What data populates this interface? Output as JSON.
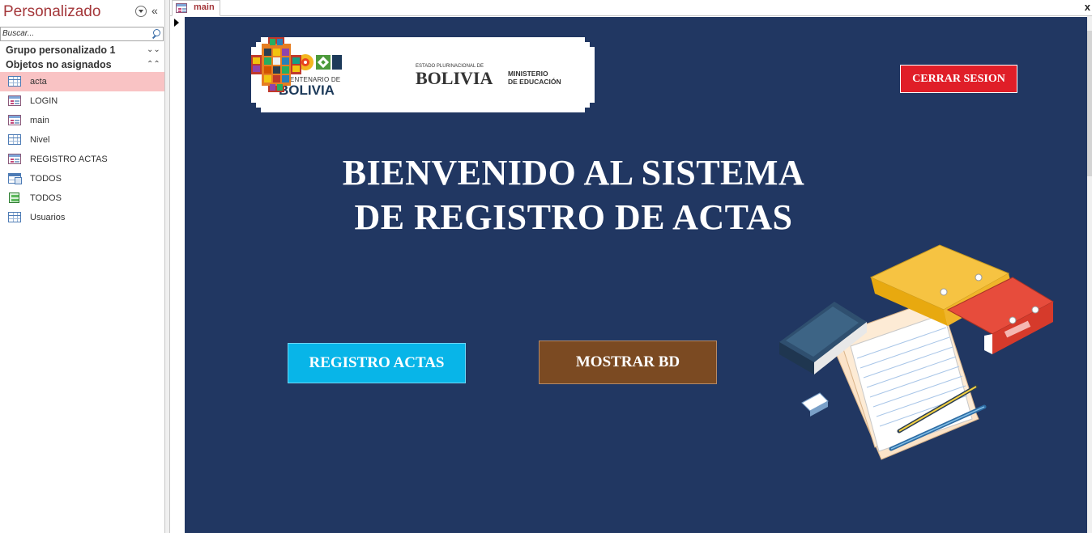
{
  "nav": {
    "title": "Personalizado",
    "search_placeholder": "Buscar...",
    "groups": [
      {
        "label": "Grupo personalizado 1"
      },
      {
        "label": "Objetos no asignados"
      }
    ],
    "items": [
      {
        "label": "acta",
        "icon": "table-icon",
        "selected": true
      },
      {
        "label": "LOGIN",
        "icon": "form-icon"
      },
      {
        "label": "main",
        "icon": "form-icon"
      },
      {
        "label": "Nivel",
        "icon": "table-icon"
      },
      {
        "label": "REGISTRO ACTAS",
        "icon": "form-icon"
      },
      {
        "label": "TODOS",
        "icon": "query-icon"
      },
      {
        "label": "TODOS",
        "icon": "report-icon"
      },
      {
        "label": "Usuarios",
        "icon": "table-icon"
      }
    ]
  },
  "document": {
    "tab_label": "main",
    "close_glyph": "x"
  },
  "form": {
    "logo": {
      "bicentenario_line1": "BICENTENARIO DE",
      "bicentenario_line2": "BOLIVIA",
      "estado_line1": "ESTADO PLURINACIONAL DE",
      "estado_line2": "BOLIVIA",
      "ministerio_line1": "MINISTERIO",
      "ministerio_line2": "DE EDUCACIÓN"
    },
    "logout_label": "CERRAR SESION",
    "welcome_line1": "BIENVENIDO AL SISTEMA",
    "welcome_line2": "DE REGISTRO DE ACTAS",
    "registro_label": "REGISTRO ACTAS",
    "mostrar_label": "MOSTRAR BD",
    "illustration": "books-and-papers-clipart"
  },
  "colors": {
    "form_background": "#213762",
    "logout_button": "#e01e28",
    "registro_button": "#08b5e8",
    "mostrar_button": "#7b4a22",
    "nav_title": "#a4373a",
    "selected_item": "#f9c3c4"
  }
}
